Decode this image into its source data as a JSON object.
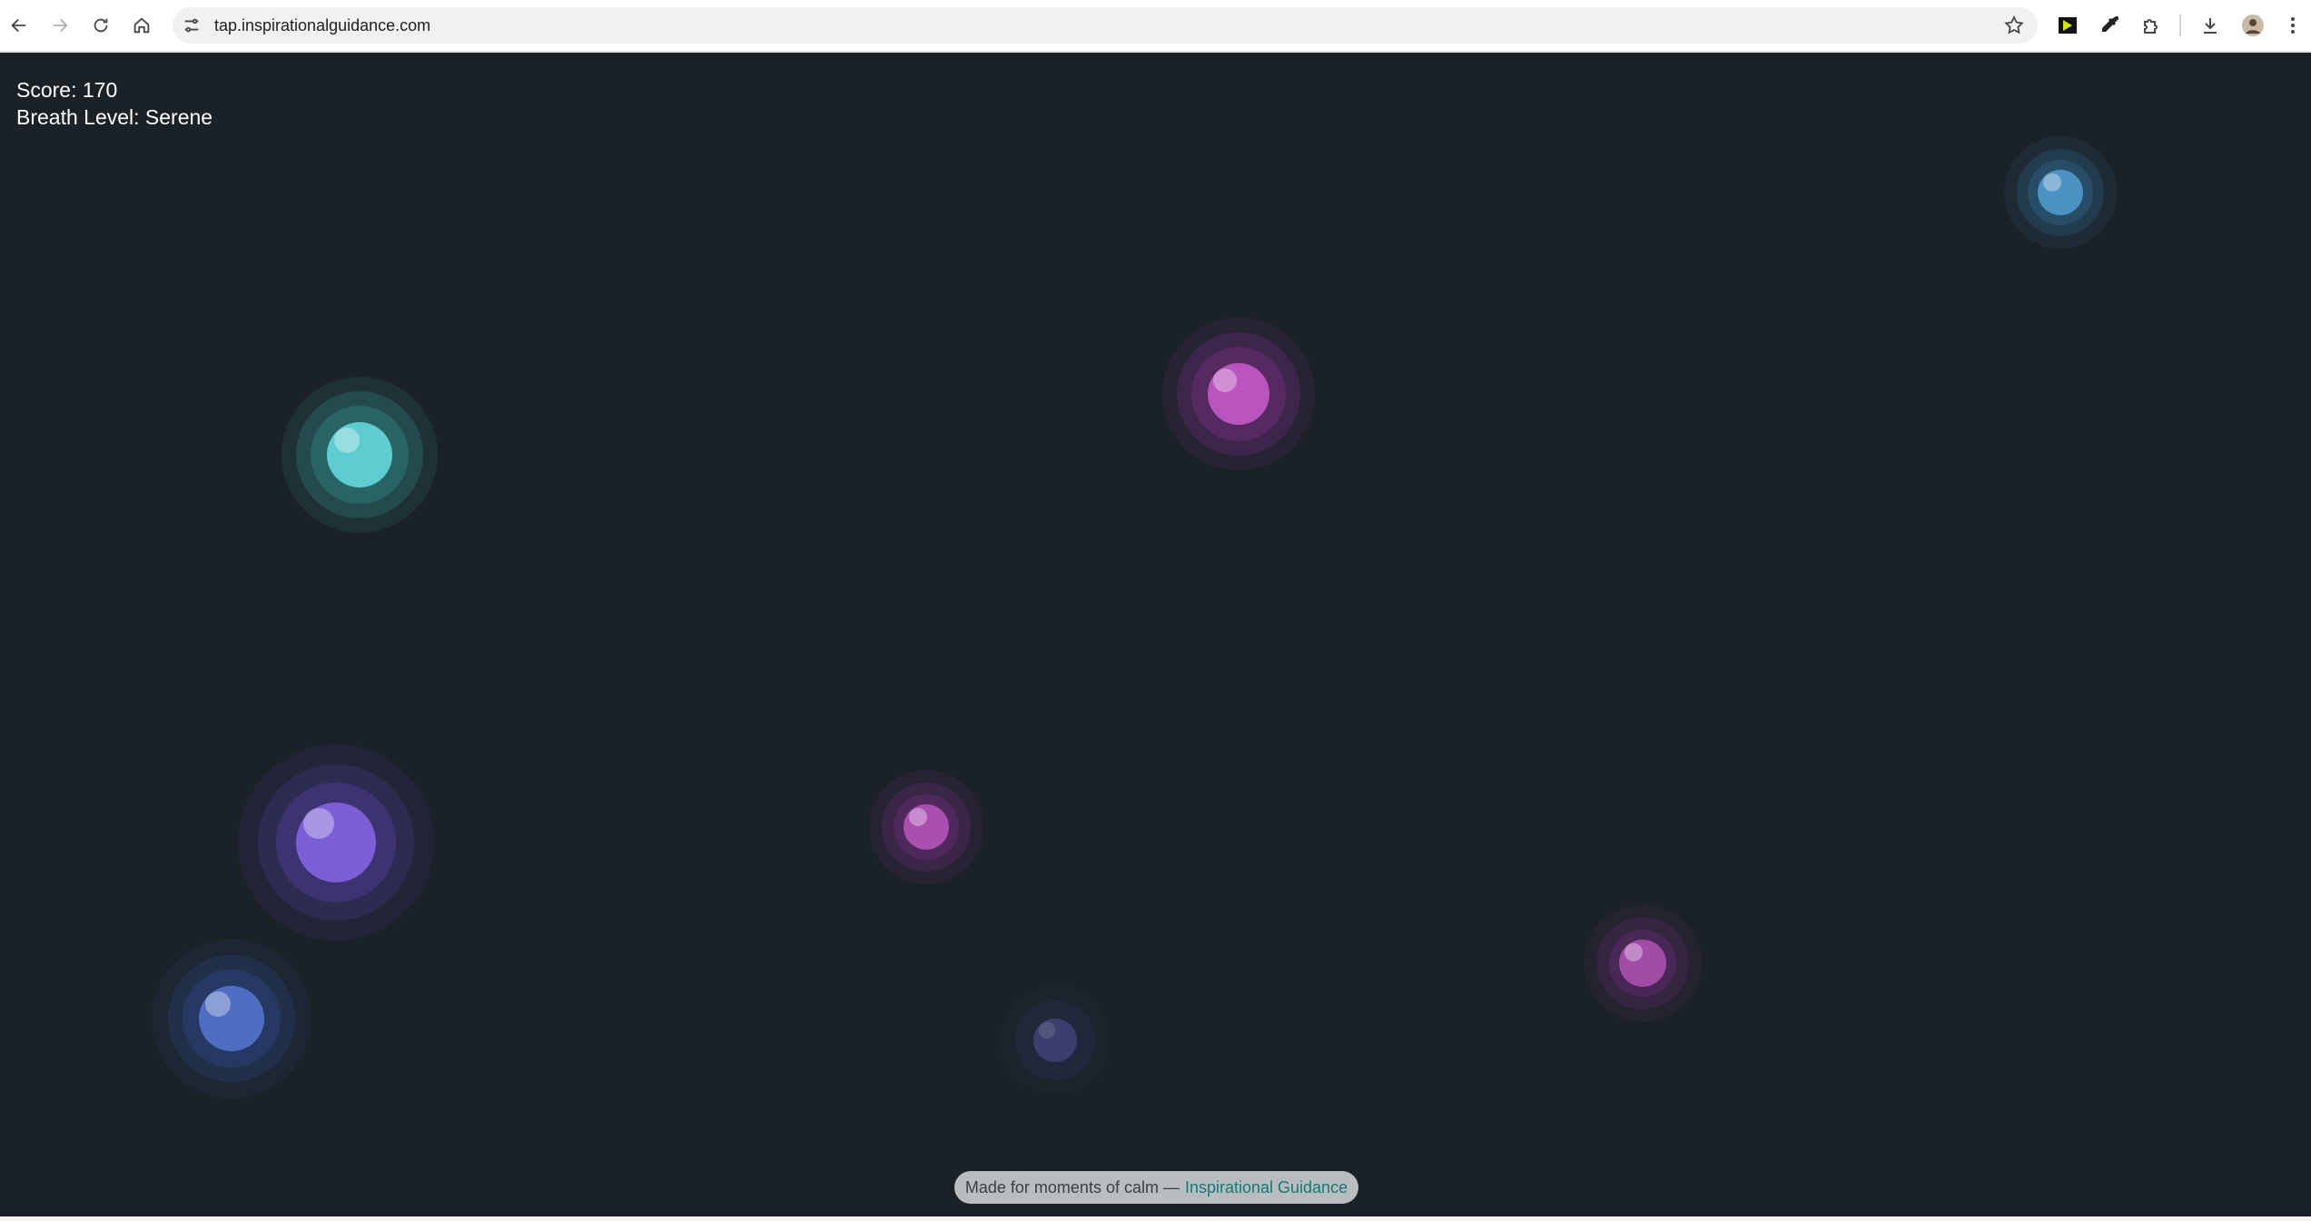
{
  "browser": {
    "url": "tap.inspirationalguidance.com",
    "nav_icons": [
      "back-arrow-icon",
      "forward-arrow-icon",
      "reload-icon",
      "home-icon"
    ],
    "site_info_icon": "tune-icon",
    "bookmark_icon": "star-icon",
    "toolbar_icons": [
      "screen-recorder-extension-icon",
      "eyedropper-extension-icon",
      "extensions-puzzle-icon",
      "download-icon",
      "profile-avatar-icon",
      "more-vert-icon"
    ]
  },
  "hud": {
    "score_label": "Score: 170",
    "breath_level_label": "Breath Level: Serene"
  },
  "orbs": [
    {
      "name": "orb-teal",
      "color": "#5ecdd0",
      "glow": "#2e7a7c"
    },
    {
      "name": "orb-magenta-top",
      "color": "#b955bd",
      "glow": "#6a2e78"
    },
    {
      "name": "orb-sky-blue",
      "color": "#4a93c2",
      "glow": "#2b5a7a"
    },
    {
      "name": "orb-violet-large",
      "color": "#7a5fd6",
      "glow": "#4a3a8c"
    },
    {
      "name": "orb-magenta-mid",
      "color": "#a84fb0",
      "glow": "#5e2c6b"
    },
    {
      "name": "orb-royal-blue",
      "color": "#4e6fc1",
      "glow": "#2c4278"
    },
    {
      "name": "orb-navy",
      "color": "#3b3f6e",
      "glow": "#292d4b"
    },
    {
      "name": "orb-magenta-right",
      "color": "#a24ca8",
      "glow": "#5a2b66"
    }
  ],
  "footer": {
    "text": "Made for moments of calm —",
    "link_text": "Inspirational Guidance",
    "link_color": "#127a74"
  }
}
